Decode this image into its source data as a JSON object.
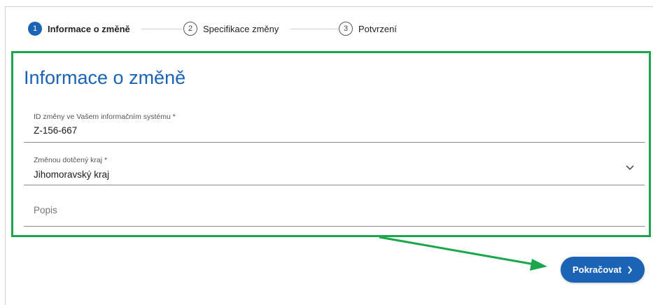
{
  "stepper": {
    "steps": [
      {
        "number": "1",
        "label": "Informace o změně",
        "state": "active"
      },
      {
        "number": "2",
        "label": "Specifikace změny",
        "state": "inactive"
      },
      {
        "number": "3",
        "label": "Potvrzení",
        "state": "inactive"
      }
    ]
  },
  "form": {
    "title": "Informace o změně",
    "fields": {
      "change_id": {
        "label": "ID změny ve Vašem informačním systému *",
        "value": "Z-156-667"
      },
      "region": {
        "label": "Změnou dotčený kraj *",
        "value": "Jihomoravský kraj"
      },
      "description": {
        "placeholder": "Popis"
      }
    }
  },
  "actions": {
    "continue_label": "Pokračovat"
  },
  "colors": {
    "primary": "#1b64b5",
    "highlight": "#1aa64b"
  },
  "icons": {
    "region_dropdown": "chevron-down-icon",
    "continue": "chevron-right-icon"
  }
}
